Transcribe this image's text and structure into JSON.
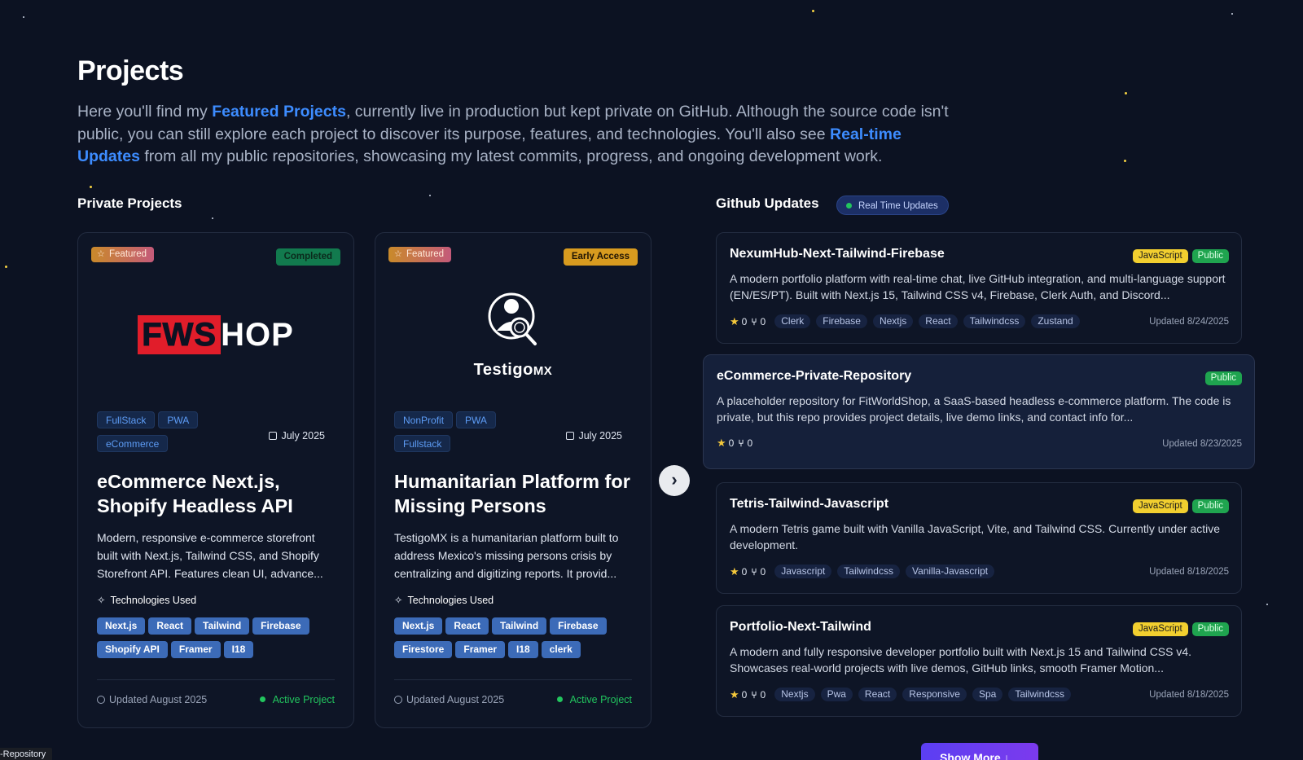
{
  "page": {
    "title": "Projects",
    "intro": {
      "part1": "Here you'll find my ",
      "hl1": "Featured Projects",
      "part2": ", currently live in production but kept private on GitHub. Although the source code isn't public, you can still explore each project to discover its purpose, features, and technologies. You'll also see ",
      "hl2": "Real-time Updates",
      "part3": " from all my public repositories, showcasing my latest commits, progress, and ongoing development work."
    }
  },
  "private_section": {
    "title": "Private Projects"
  },
  "github_section": {
    "title": "Github Updates",
    "badge": "Real Time Updates"
  },
  "projects": [
    {
      "featured_label": "Featured",
      "status": "Completed",
      "logo": {
        "red": "FWS",
        "white": "HOP"
      },
      "categories": [
        "FullStack",
        "PWA",
        "eCommerce"
      ],
      "date": "July 2025",
      "title": "eCommerce Next.js, Shopify Headless API",
      "description": "Modern, responsive e-commerce storefront built with Next.js, Tailwind CSS, and Shopify Storefront API. Features clean UI, advance...",
      "tech_label": "Technologies Used",
      "technologies": [
        "Next.js",
        "React",
        "Tailwind",
        "Firebase",
        "Shopify API",
        "Framer",
        "I18"
      ],
      "updated": "Updated August 2025",
      "active": "Active Project"
    },
    {
      "featured_label": "Featured",
      "status": "Early Access",
      "logo": {
        "main": "Testigo",
        "suffix": "MX"
      },
      "categories": [
        "NonProfit",
        "PWA",
        "Fullstack"
      ],
      "date": "July 2025",
      "title": "Humanitarian Platform for Missing Persons",
      "description": "TestigoMX is a humanitarian platform built to address Mexico's missing persons crisis by centralizing and digitizing reports. It provid...",
      "tech_label": "Technologies Used",
      "technologies": [
        "Next.js",
        "React",
        "Tailwind",
        "Firebase",
        "Firestore",
        "Framer",
        "I18",
        "clerk"
      ],
      "updated": "Updated August 2025",
      "active": "Active Project"
    }
  ],
  "next_button": "›",
  "repos": [
    {
      "name": "NexumHub-Next-Tailwind-Firebase",
      "languages": [
        "JavaScript",
        "Public"
      ],
      "description": "A modern portfolio platform with real-time chat, live GitHub integration, and multi-language support (EN/ES/PT). Built with Next.js 15, Tailwind CSS v4, Firebase, Clerk Auth, and Discord...",
      "stars": "0",
      "forks": "0",
      "topics": [
        "Clerk",
        "Firebase",
        "Nextjs",
        "React",
        "Tailwindcss",
        "Zustand"
      ],
      "updated": "Updated 8/24/2025"
    },
    {
      "name": "eCommerce-Private-Repository",
      "languages": [
        "Public"
      ],
      "description": "A placeholder repository for FitWorldShop, a SaaS-based headless e-commerce platform. The code is private, but this repo provides project details, live demo links, and contact info for...",
      "stars": "0",
      "forks": "0",
      "topics": [],
      "updated": "Updated 8/23/2025"
    },
    {
      "name": "Tetris-Tailwind-Javascript",
      "languages": [
        "JavaScript",
        "Public"
      ],
      "description": "A modern Tetris game built with Vanilla JavaScript, Vite, and Tailwind CSS. Currently under active development.",
      "stars": "0",
      "forks": "0",
      "topics": [
        "Javascript",
        "Tailwindcss",
        "Vanilla-Javascript"
      ],
      "updated": "Updated 8/18/2025"
    },
    {
      "name": "Portfolio-Next-Tailwind",
      "languages": [
        "JavaScript",
        "Public"
      ],
      "description": "A modern and fully responsive developer portfolio built with Next.js 15 and Tailwind CSS v4. Showcases real-world projects with live demos, GitHub links, smooth Framer Motion...",
      "stars": "0",
      "forks": "0",
      "topics": [
        "Nextjs",
        "Pwa",
        "React",
        "Responsive",
        "Spa",
        "Tailwindcss"
      ],
      "updated": "Updated 8/18/2025"
    }
  ],
  "show_more": "Show More",
  "tooltip": "-Repository",
  "colors": {
    "background": "#0c1222",
    "accent_blue": "#3d8cff",
    "active_green": "#22c55e",
    "js_yellow": "#f2cf2f",
    "show_more_purple": "#6d3cf0"
  },
  "icons": {
    "featured": "star-outline-icon",
    "date": "calendar-icon",
    "tech": "sparkles-icon",
    "updated": "clock-icon",
    "repo_star": "star-icon",
    "repo_fork": "fork-icon",
    "next": "chevron-right-icon",
    "show_more": "arrow-down-icon"
  }
}
